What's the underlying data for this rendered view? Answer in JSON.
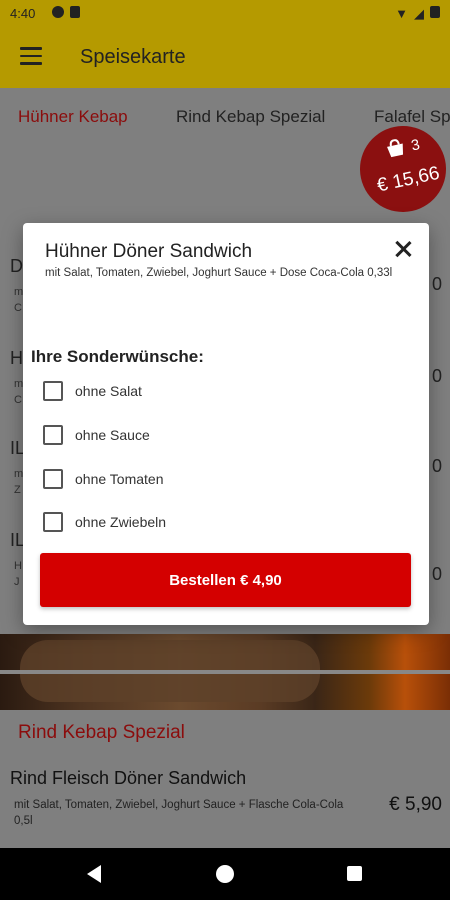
{
  "status_bar": {
    "time": "4:40"
  },
  "app_bar": {
    "title": "Speisekarte"
  },
  "tabs": [
    {
      "label": "Hühner Kebap"
    },
    {
      "label": "Rind Kebap Spezial"
    },
    {
      "label": "Falafel Sp"
    }
  ],
  "cart": {
    "count": "3",
    "total": "€ 15,66"
  },
  "background_rows": [
    {
      "title": "D",
      "desc": "m",
      "desc2": "C",
      "price": "0"
    },
    {
      "title": "H",
      "desc": "m",
      "desc2": "C",
      "price": "0"
    },
    {
      "title": "IL",
      "desc": "m",
      "desc2": "Z",
      "price": "0"
    },
    {
      "title": "IL",
      "desc": "H",
      "desc2": "J",
      "price": "0"
    }
  ],
  "section": {
    "title": "Rind Kebap Spezial"
  },
  "bottom_item": {
    "title": "Rind Fleisch Döner Sandwich",
    "desc": "mit Salat, Tomaten, Zwiebel, Joghurt Sauce + Flasche Cola-Cola 0,5l",
    "price": "€ 5,90"
  },
  "dialog": {
    "title": "Hühner Döner Sandwich",
    "subtitle": "mit Salat, Tomaten, Zwiebel, Joghurt Sauce + Dose Coca-Cola 0,33l",
    "section_label": "Ihre Sonderwünsche:",
    "options": [
      {
        "label": "ohne Salat",
        "checked": false
      },
      {
        "label": "ohne Sauce",
        "checked": false
      },
      {
        "label": "ohne Tomaten",
        "checked": false
      },
      {
        "label": "ohne Zwiebeln",
        "checked": false
      }
    ],
    "order_button": "Bestellen € 4,90"
  },
  "colors": {
    "app_bar": "#b59a00",
    "accent_red": "#d40000",
    "tab_active": "#8b0c0c",
    "cart_badge": "#8b1010"
  }
}
